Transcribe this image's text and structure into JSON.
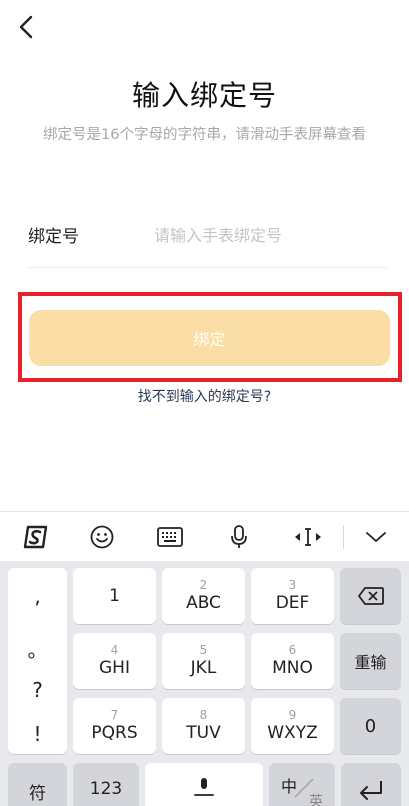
{
  "header": {
    "back_icon": "chevron-left-icon"
  },
  "title": "输入绑定号",
  "subtitle": "绑定号是16个字母的字符串，请滑动手表屏幕查看",
  "form": {
    "label": "绑定号",
    "placeholder": "请输入手表绑定号",
    "value": ""
  },
  "bind_button": {
    "label": "绑定",
    "color": "#fbdda6"
  },
  "help_link": "找不到输入的绑定号?",
  "keyboard": {
    "toolbar": {
      "icons": [
        "sogou-logo-icon",
        "emoji-icon",
        "keyboard-icon",
        "microphone-icon",
        "cursor-move-icon",
        "collapse-chevron-icon"
      ]
    },
    "symbols": [
      ",",
      "。",
      "?",
      "!"
    ],
    "keys": [
      {
        "num": "",
        "letters": "1"
      },
      {
        "num": "2",
        "letters": "ABC"
      },
      {
        "num": "3",
        "letters": "DEF"
      },
      {
        "num": "4",
        "letters": "GHI"
      },
      {
        "num": "5",
        "letters": "JKL"
      },
      {
        "num": "6",
        "letters": "MNO"
      },
      {
        "num": "7",
        "letters": "PQRS"
      },
      {
        "num": "8",
        "letters": "TUV"
      },
      {
        "num": "9",
        "letters": "WXYZ"
      }
    ],
    "right": {
      "delete_icon": "backspace-icon",
      "reenter": "重输",
      "zero": "0"
    },
    "bottom": {
      "symbol": "符",
      "numbers": "123",
      "lang_cn": "中",
      "lang_en": "英",
      "enter_icon": "enter-icon",
      "mic_icon": "space-mic-icon"
    }
  }
}
